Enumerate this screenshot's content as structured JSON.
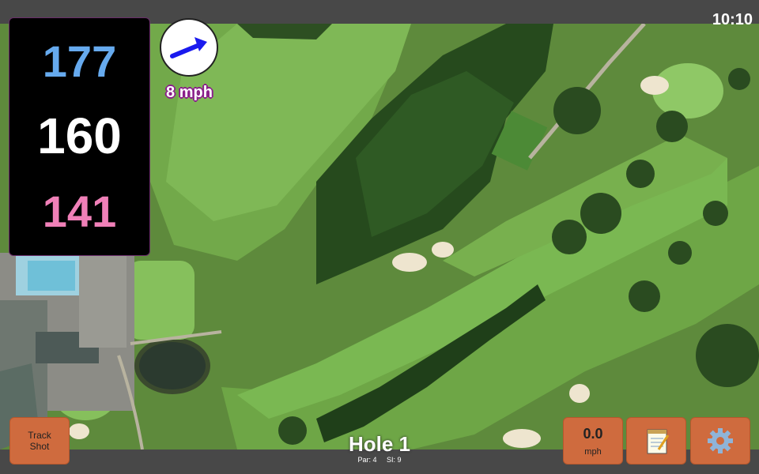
{
  "status": {
    "time": "10:10"
  },
  "distances": {
    "back": "177",
    "middle": "160",
    "front": "141"
  },
  "wind": {
    "speed": "8 mph",
    "icon": "arrow-icon"
  },
  "hole": {
    "title": "Hole 1",
    "par": "Par: 4",
    "stroke_index": "SI: 9"
  },
  "buttons": {
    "track_shot": "Track\nShot",
    "speed_value": "0.0",
    "speed_unit": "mph",
    "notes_icon": "notepad-icon",
    "settings_icon": "gear-icon"
  },
  "colors": {
    "back": "#66aaee",
    "middle": "#ffffff",
    "front": "#f080b8",
    "button": "#cf6b3e"
  }
}
